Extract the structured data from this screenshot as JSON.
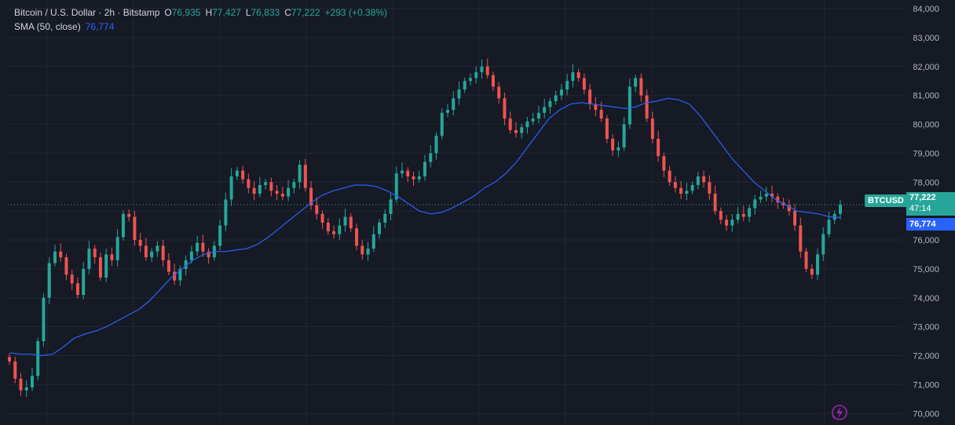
{
  "legend": {
    "symbol": "Bitcoin / U.S. Dollar · 2h · Bitstamp",
    "o_label": "O",
    "o_value": "76,935",
    "h_label": "H",
    "h_value": "77,427",
    "l_label": "L",
    "l_value": "76,833",
    "c_label": "C",
    "c_value": "77,222",
    "change": "+293 (+0.38%)",
    "sma_name": "SMA (50, close)",
    "sma_value": "76,774"
  },
  "badges": {
    "ticker": "BTCUSD",
    "price": "77,222",
    "countdown": "47:14",
    "sma": "76,774"
  },
  "colors": {
    "background": "#161a25",
    "up": "#26a69a",
    "down": "#ef5350",
    "sma": "#2962ff",
    "grid": "#232734"
  },
  "icons": {
    "quick_action": "lightning-bolt-icon"
  },
  "chart_data": {
    "type": "candlestick",
    "ylim": [
      69600,
      84300
    ],
    "y_ticks": [
      "84,000",
      "83,000",
      "82,000",
      "81,000",
      "80,000",
      "79,000",
      "78,000",
      "77,000",
      "76,000",
      "75,000",
      "74,000",
      "73,000",
      "72,000",
      "71,000",
      "70,000"
    ],
    "last_price": 77222,
    "close": [
      71800,
      71200,
      70800,
      70900,
      71300,
      72500,
      74000,
      75200,
      75600,
      75400,
      74800,
      74500,
      74100,
      75000,
      75700,
      75400,
      74700,
      75500,
      75300,
      76100,
      76900,
      76800,
      76000,
      75800,
      75400,
      75600,
      75800,
      75300,
      74900,
      74600,
      75000,
      75300,
      75600,
      75900,
      75600,
      75400,
      75800,
      76500,
      77400,
      78200,
      78400,
      78100,
      77800,
      77600,
      77900,
      78000,
      77700,
      77600,
      77500,
      77800,
      78000,
      78600,
      77800,
      77200,
      76900,
      76600,
      76300,
      76200,
      76500,
      76800,
      76400,
      75800,
      75500,
      75700,
      76200,
      76600,
      76900,
      77400,
      78300,
      78400,
      78200,
      78100,
      78200,
      78700,
      79000,
      79600,
      80400,
      80500,
      80900,
      81200,
      81500,
      81600,
      81800,
      82000,
      81700,
      81300,
      80900,
      80200,
      79800,
      79700,
      79900,
      80100,
      80200,
      80400,
      80600,
      80800,
      81000,
      81200,
      81500,
      81800,
      81600,
      81200,
      80700,
      80500,
      80200,
      79500,
      79100,
      79200,
      80000,
      81300,
      81600,
      81000,
      80200,
      79500,
      78900,
      78400,
      78000,
      77800,
      77600,
      77700,
      77900,
      78200,
      78000,
      77600,
      77000,
      76700,
      76500,
      76700,
      76900,
      76800,
      77100,
      77400,
      77500,
      77600,
      77500,
      77300,
      77200,
      77000,
      76500,
      75600,
      75000,
      74800,
      75500,
      76200,
      76700,
      76900,
      77222
    ],
    "sma_50": [
      72100,
      72050,
      72050,
      72000,
      72050,
      72300,
      72600,
      72750,
      72850,
      73000,
      73200,
      73400,
      73600,
      73900,
      74300,
      74700,
      75000,
      75300,
      75500,
      75600,
      75600,
      75650,
      75700,
      75850,
      76100,
      76400,
      76700,
      77000,
      77300,
      77550,
      77700,
      77800,
      77900,
      77900,
      77850,
      77700,
      77500,
      77250,
      77000,
      76900,
      76950,
      77100,
      77300,
      77500,
      77800,
      78000,
      78300,
      78700,
      79200,
      79700,
      80200,
      80500,
      80700,
      80750,
      80700,
      80650,
      80600,
      80550,
      80600,
      80750,
      80800,
      80900,
      80850,
      80700,
      80300,
      79800,
      79300,
      78800,
      78400,
      78000,
      77700,
      77400,
      77200,
      77000,
      76950,
      76900,
      76800,
      76774
    ]
  }
}
